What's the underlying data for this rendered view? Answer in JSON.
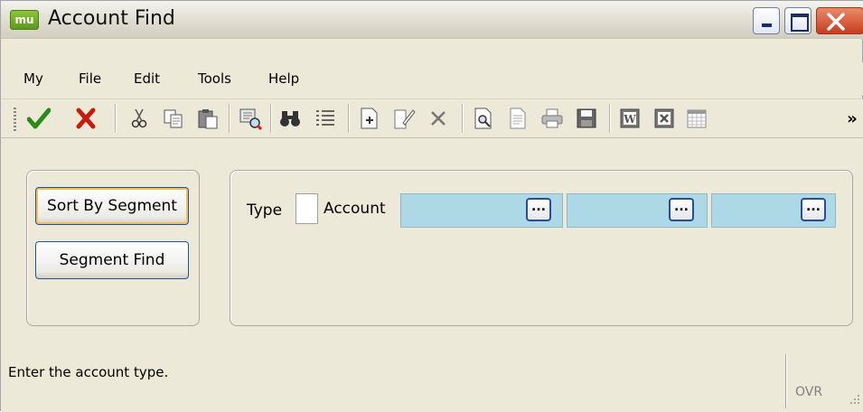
{
  "window": {
    "app_icon_text": "mu",
    "title": "Account Find"
  },
  "menu": {
    "items": [
      "My",
      "File",
      "Edit",
      "Tools",
      "Help"
    ]
  },
  "toolbar": {
    "overflow_glyph": "»",
    "icons": [
      "checkmark-icon",
      "cancel-x-icon",
      "cut-icon",
      "copy-icon",
      "paste-icon",
      "find-record-icon",
      "binoculars-icon",
      "list-icon",
      "new-document-icon",
      "edit-document-icon",
      "delete-icon",
      "print-preview-icon",
      "document-icon",
      "print-icon",
      "save-icon",
      "word-icon",
      "excel-icon",
      "calendar-icon"
    ]
  },
  "left_panel": {
    "sort_button": "Sort By Segment",
    "segment_find_button": "Segment Find"
  },
  "right_panel": {
    "type_label": "Type",
    "type_value": "",
    "account_label": "Account",
    "segments": [
      "",
      "",
      ""
    ],
    "ellipsis_label": "..."
  },
  "status": {
    "message": "Enter the account type.",
    "mode": "OVR"
  }
}
